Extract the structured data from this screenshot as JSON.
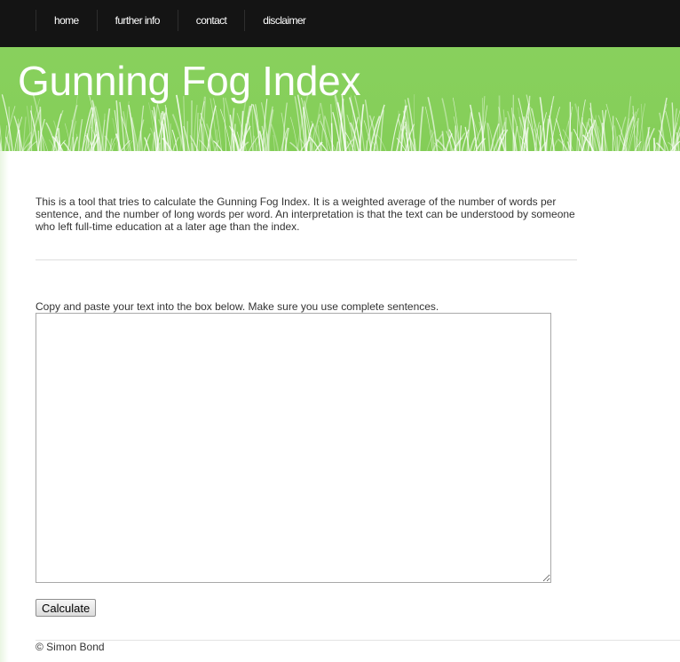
{
  "nav": {
    "items": [
      {
        "label": "home"
      },
      {
        "label": "further info"
      },
      {
        "label": "contact"
      },
      {
        "label": "disclaimer"
      }
    ]
  },
  "header": {
    "title": "Gunning Fog Index",
    "background_color": "#86cf5a"
  },
  "main": {
    "intro": "This is a tool that tries to calculate the Gunning Fog Index. It is a weighted average of the number of words per sentence, and the number of long words per word. An interpretation is that the text can be understood by someone who left full-time education at a later age than the index.",
    "instruction": "Copy and paste your text into the box below. Make sure you use complete sentences.",
    "text_input_value": "",
    "calculate_label": "Calculate"
  },
  "footer": {
    "text": "© Simon Bond"
  }
}
